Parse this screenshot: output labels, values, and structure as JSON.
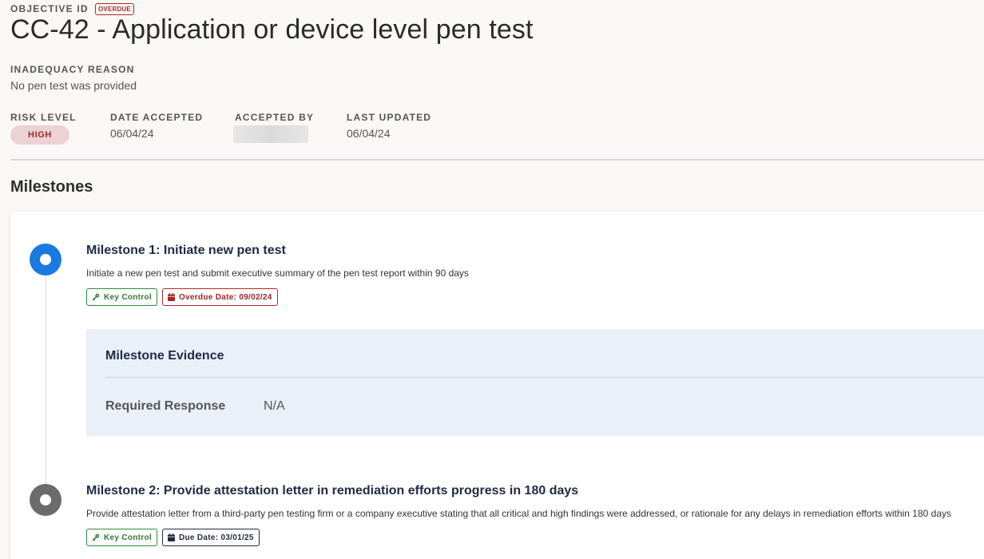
{
  "header": {
    "objective_id_label": "OBJECTIVE ID",
    "status_badge": "OVERDUE",
    "title": "CC-42 - Application or device level pen test"
  },
  "inadequacy": {
    "label": "INADEQUACY REASON",
    "value": "No pen test was provided"
  },
  "meta": {
    "risk_level_label": "RISK LEVEL",
    "risk_level_value": "HIGH",
    "date_accepted_label": "DATE ACCEPTED",
    "date_accepted_value": "06/04/24",
    "accepted_by_label": "ACCEPTED BY",
    "last_updated_label": "LAST UPDATED",
    "last_updated_value": "06/04/24"
  },
  "milestones_section": {
    "title": "Milestones"
  },
  "milestones": [
    {
      "title": "Milestone 1: Initiate new pen test",
      "description": "Initiate a new pen test and submit executive summary of the pen test report within 90 days",
      "key_control_tag": "Key Control",
      "date_tag": "Overdue Date: 09/02/24",
      "status_color": "#1a7ae0",
      "evidence": {
        "title": "Milestone Evidence",
        "required_response_label": "Required Response",
        "required_response_value": "N/A"
      }
    },
    {
      "title": "Milestone 2: Provide attestation letter in remediation efforts progress in 180 days",
      "description": "Provide attestation letter from a third-party pen testing firm or a company executive stating that all critical and high findings were addressed, or rationale for any delays in remediation efforts within 180 days",
      "key_control_tag": "Key Control",
      "date_tag": "Due Date: 03/01/25",
      "status_color": "#6b6b6b"
    }
  ],
  "colors": {
    "overdue_red": "#b02a2a",
    "key_control_green": "#2e7d32",
    "navy": "#1f2a44",
    "evidence_bg": "#eaf0f8"
  }
}
